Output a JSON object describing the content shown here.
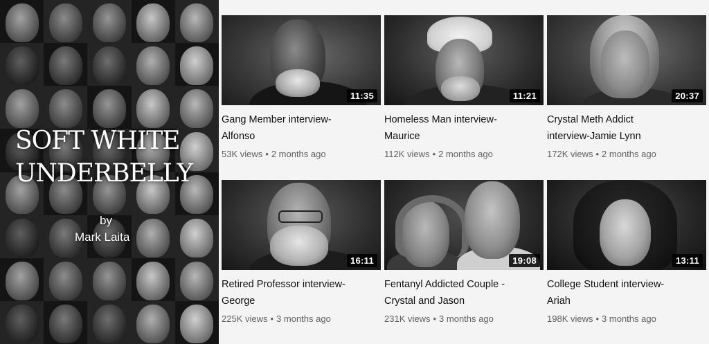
{
  "banner": {
    "title_line1": "SOFT WHITE",
    "title_line2": "UNDERBELLY",
    "by": "by",
    "author": "Mark Laita"
  },
  "videos": [
    {
      "title_line1": "Gang Member interview-",
      "title_line2": "Alfonso",
      "views": "53K views",
      "age": "2 months ago",
      "duration": "11:35"
    },
    {
      "title_line1": "Homeless Man interview-",
      "title_line2": "Maurice",
      "views": "112K views",
      "age": "2 months ago",
      "duration": "11:21"
    },
    {
      "title_line1": "Crystal Meth Addict",
      "title_line2": "interview-Jamie Lynn",
      "views": "172K views",
      "age": "2 months ago",
      "duration": "20:37"
    },
    {
      "title_line1": "Retired Professor interview-",
      "title_line2": "George",
      "views": "225K views",
      "age": "3 months ago",
      "duration": "16:11"
    },
    {
      "title_line1": "Fentanyl Addicted Couple -",
      "title_line2": "Crystal and Jason",
      "views": "231K views",
      "age": "3 months ago",
      "duration": "19:08"
    },
    {
      "title_line1": "College Student interview-",
      "title_line2": "Ariah",
      "views": "198K views",
      "age": "3 months ago",
      "duration": "13:11"
    }
  ],
  "separator": "•"
}
